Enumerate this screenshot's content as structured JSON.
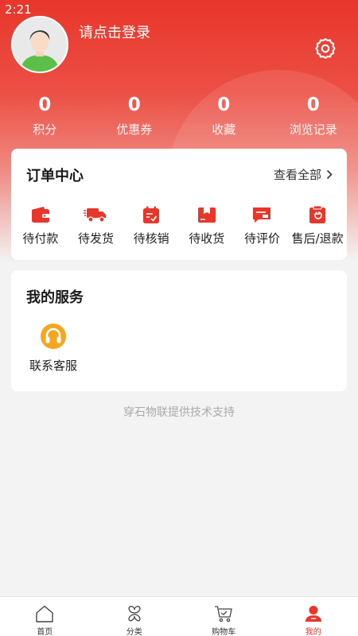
{
  "status_bar": {
    "time": "2:21"
  },
  "profile": {
    "login_prompt": "请点击登录"
  },
  "stats": [
    {
      "value": "0",
      "label": "积分"
    },
    {
      "value": "0",
      "label": "优惠券"
    },
    {
      "value": "0",
      "label": "收藏"
    },
    {
      "value": "0",
      "label": "浏览记录"
    }
  ],
  "orders": {
    "title": "订单中心",
    "view_all": "查看全部",
    "items": [
      {
        "label": "待付款",
        "icon": "wallet-icon"
      },
      {
        "label": "待发货",
        "icon": "truck-icon"
      },
      {
        "label": "待核销",
        "icon": "calendar-check-icon"
      },
      {
        "label": "待收货",
        "icon": "box-icon"
      },
      {
        "label": "待评价",
        "icon": "comment-icon"
      },
      {
        "label": "售后/退款",
        "icon": "refund-icon"
      }
    ]
  },
  "services": {
    "title": "我的服务",
    "items": [
      {
        "label": "联系客服",
        "icon": "headset-icon"
      }
    ]
  },
  "footer_note": "穿石物联提供技术支持",
  "tabbar": {
    "active_index": 3,
    "items": [
      {
        "label": "首页",
        "icon": "home-icon"
      },
      {
        "label": "分类",
        "icon": "category-icon"
      },
      {
        "label": "购物车",
        "icon": "cart-icon"
      },
      {
        "label": "我的",
        "icon": "user-icon"
      }
    ]
  },
  "colors": {
    "accent": "#e8362b",
    "background": "#f3f3f3",
    "service_icon": "#f7a51f"
  }
}
